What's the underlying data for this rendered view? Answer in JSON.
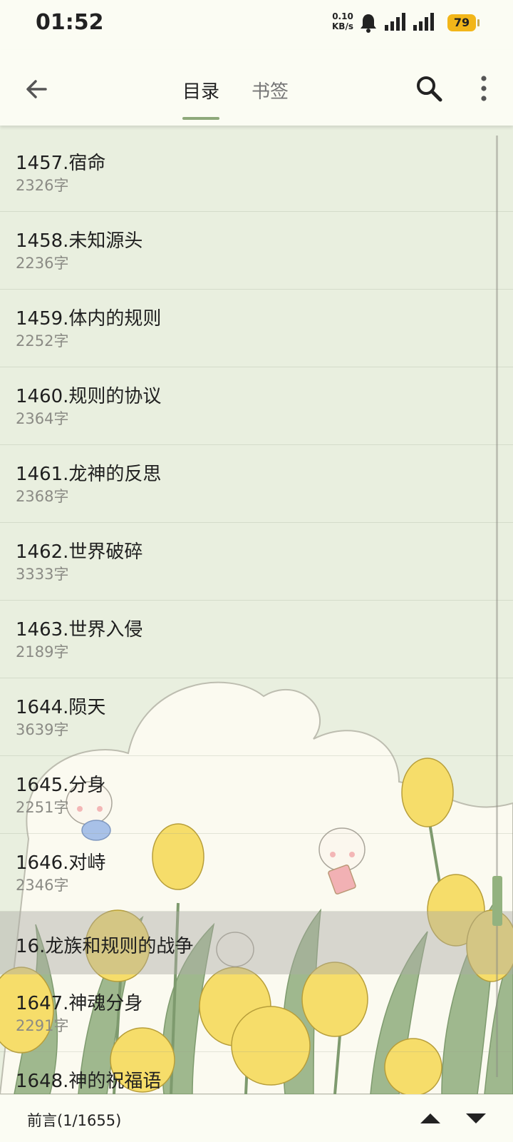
{
  "status_bar": {
    "time": "01:52",
    "network_speed_value": "0.10",
    "network_speed_unit": "KB/s",
    "battery": "79",
    "icons": [
      "bell-icon",
      "signal-icon",
      "signal-icon"
    ]
  },
  "app_bar": {
    "tabs": [
      {
        "label": "目录",
        "active": true
      },
      {
        "label": "书签",
        "active": false
      }
    ],
    "icons": [
      "back-arrow-icon",
      "search-icon",
      "more-vert-icon"
    ]
  },
  "chapters_before_volume": [
    {
      "title": "1457.宿命",
      "words": "2326字"
    },
    {
      "title": "1458.未知源头",
      "words": "2236字"
    },
    {
      "title": "1459.体内的规则",
      "words": "2252字"
    },
    {
      "title": "1460.规则的协议",
      "words": "2364字"
    },
    {
      "title": "1461.龙神的反思",
      "words": "2368字"
    },
    {
      "title": "1462.世界破碎",
      "words": "3333字"
    },
    {
      "title": "1463.世界入侵",
      "words": "2189字"
    },
    {
      "title": "1644.陨天",
      "words": "3639字"
    },
    {
      "title": "1645.分身",
      "words": "2251字"
    },
    {
      "title": "1646.对峙",
      "words": "2346字"
    }
  ],
  "volume": {
    "title": "16.龙族和规则的战争"
  },
  "chapters_after_volume": [
    {
      "title": "1647.神魂分身",
      "words": "2291字"
    },
    {
      "title": "1648.神的祝福语",
      "words": ""
    }
  ],
  "bottom_bar": {
    "progress": "前言(1/1655)",
    "icons": [
      "scroll-up-icon",
      "scroll-down-icon"
    ]
  },
  "colors": {
    "list_background": "#e9efdf",
    "bar_background": "#fbfcf3",
    "accent": "#8ea97a",
    "battery": "#f2b619"
  }
}
